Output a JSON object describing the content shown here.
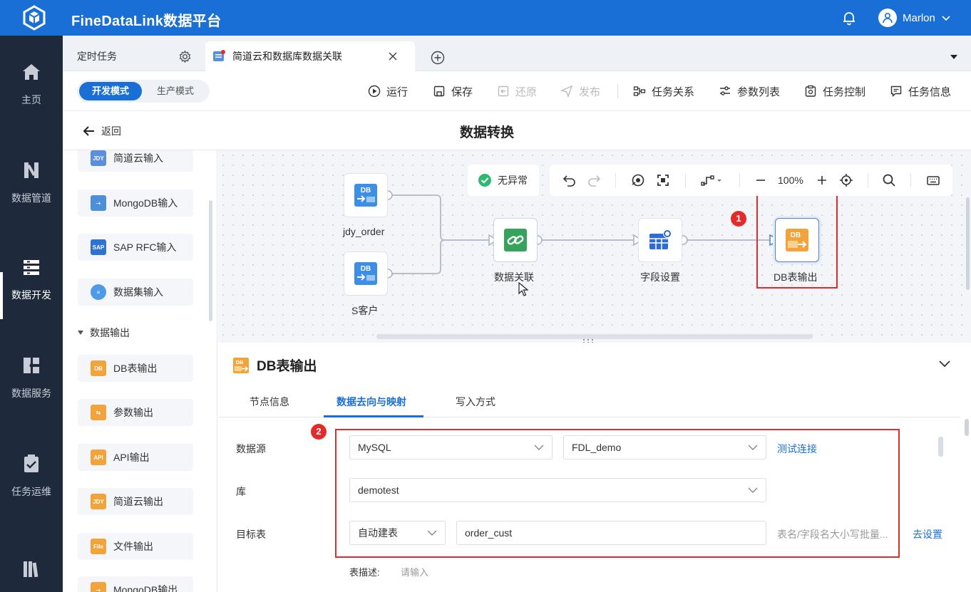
{
  "app": {
    "title": "FineDataLink数据平台",
    "user": "Marlon"
  },
  "sidenav": {
    "items": [
      {
        "label": "主页"
      },
      {
        "label": "数据管道"
      },
      {
        "label": "数据开发"
      },
      {
        "label": "数据服务"
      },
      {
        "label": "任务运维"
      }
    ]
  },
  "tabs": {
    "tab1": "定时任务",
    "tab2": "简道云和数据库数据关联"
  },
  "toolbar": {
    "mode_dev": "开发模式",
    "mode_prod": "生产模式",
    "run": "运行",
    "save": "保存",
    "restore": "还原",
    "publish": "发布",
    "relations": "任务关系",
    "params": "参数列表",
    "control": "任务控制",
    "info": "任务信息"
  },
  "header": {
    "back": "返回",
    "title": "数据转换"
  },
  "palette": {
    "items": [
      "简道云输入",
      "MongoDB输入",
      "SAP RFC输入",
      "数据集输入"
    ],
    "group": "数据输出",
    "outputs": [
      "DB表输出",
      "参数输出",
      "API输出",
      "简道云输出",
      "文件输出",
      "MongoDB输出"
    ],
    "icon_tags": {
      "jdy": "JDY",
      "db": "DB",
      "api": "API",
      "file": "File",
      "sap": "SAP"
    }
  },
  "canvas": {
    "status": "无异常",
    "zoom": "100%",
    "nodes": {
      "jdy": "jdy_order",
      "s": "S客户",
      "join": "数据关联",
      "fields": "字段设置",
      "out": "DB表输出"
    },
    "badge1": "1"
  },
  "props": {
    "title": "DB表输出",
    "tabs": [
      "节点信息",
      "数据去向与映射",
      "写入方式"
    ],
    "datasource_label": "数据源",
    "datasource_type": "MySQL",
    "datasource_conn": "FDL_demo",
    "test_link": "测试连接",
    "db_label": "库",
    "db_value": "demotest",
    "target_label": "目标表",
    "target_mode": "自动建表",
    "target_name": "order_cust",
    "case_hint": "表名/字段名大小写批量...",
    "goto_settings": "去设置",
    "desc_label": "表描述:",
    "desc_placeholder": "请输入",
    "badge2": "2"
  },
  "colors": {
    "brand": "#1a6fd6",
    "sidebar": "#1e2a3c",
    "highlight": "#e32b2b"
  }
}
